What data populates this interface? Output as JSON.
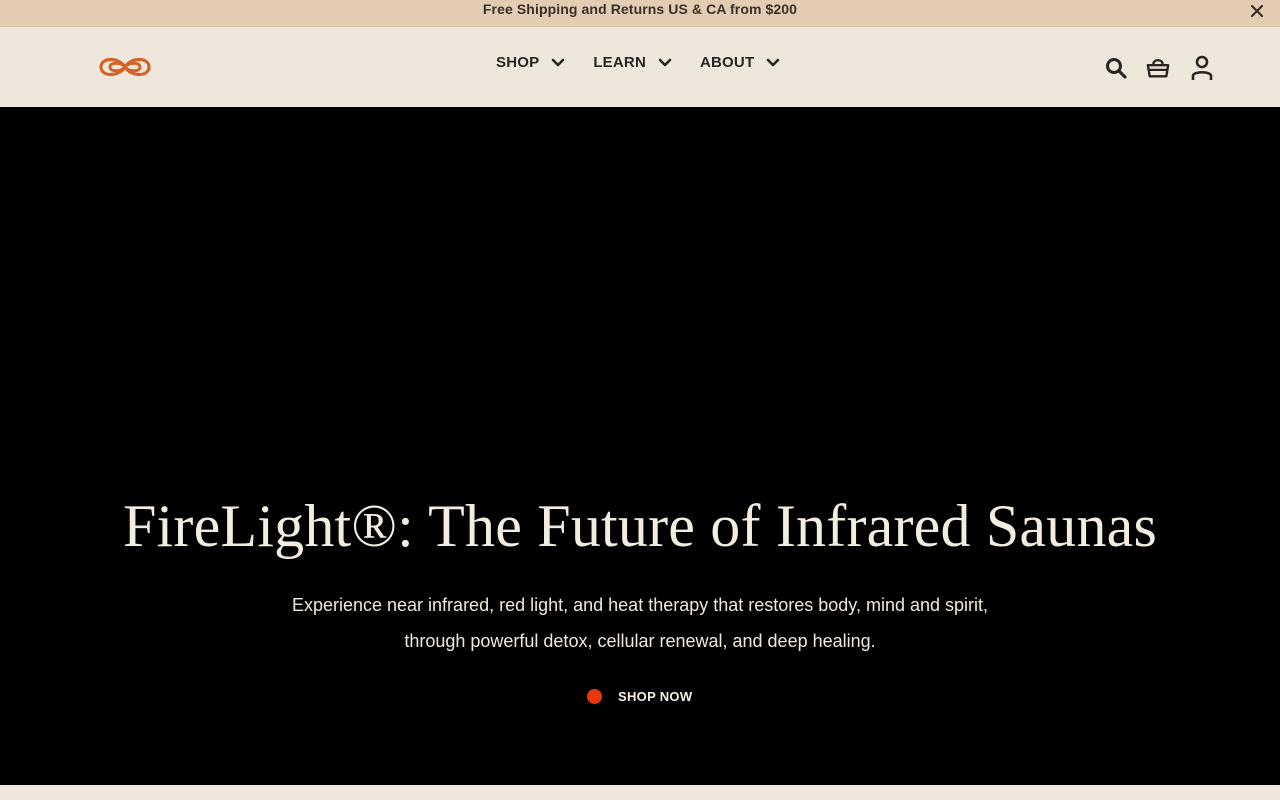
{
  "announcement": {
    "text": "Free Shipping and Returns US & CA from $200",
    "close_icon": "close-icon"
  },
  "header": {
    "logo_icon": "infinity-logo-icon",
    "nav": [
      {
        "label": "SHOP"
      },
      {
        "label": "LEARN"
      },
      {
        "label": "ABOUT"
      }
    ],
    "icons": [
      "search-icon",
      "cart-icon",
      "account-icon"
    ]
  },
  "hero": {
    "title": "FireLight®: The Future of Infrared Saunas",
    "subtitle": "Experience near infrared, red light, and heat therapy that restores body, mind and spirit, through powerful detox, cellular renewal, and deep healing.",
    "cta_label": "SHOP NOW"
  },
  "colors": {
    "announcement_bg": "#e2cdb2",
    "header_bg": "#f0e7dc",
    "hero_bg": "#000000",
    "accent": "#e8380e",
    "logo": "#d2642a"
  }
}
